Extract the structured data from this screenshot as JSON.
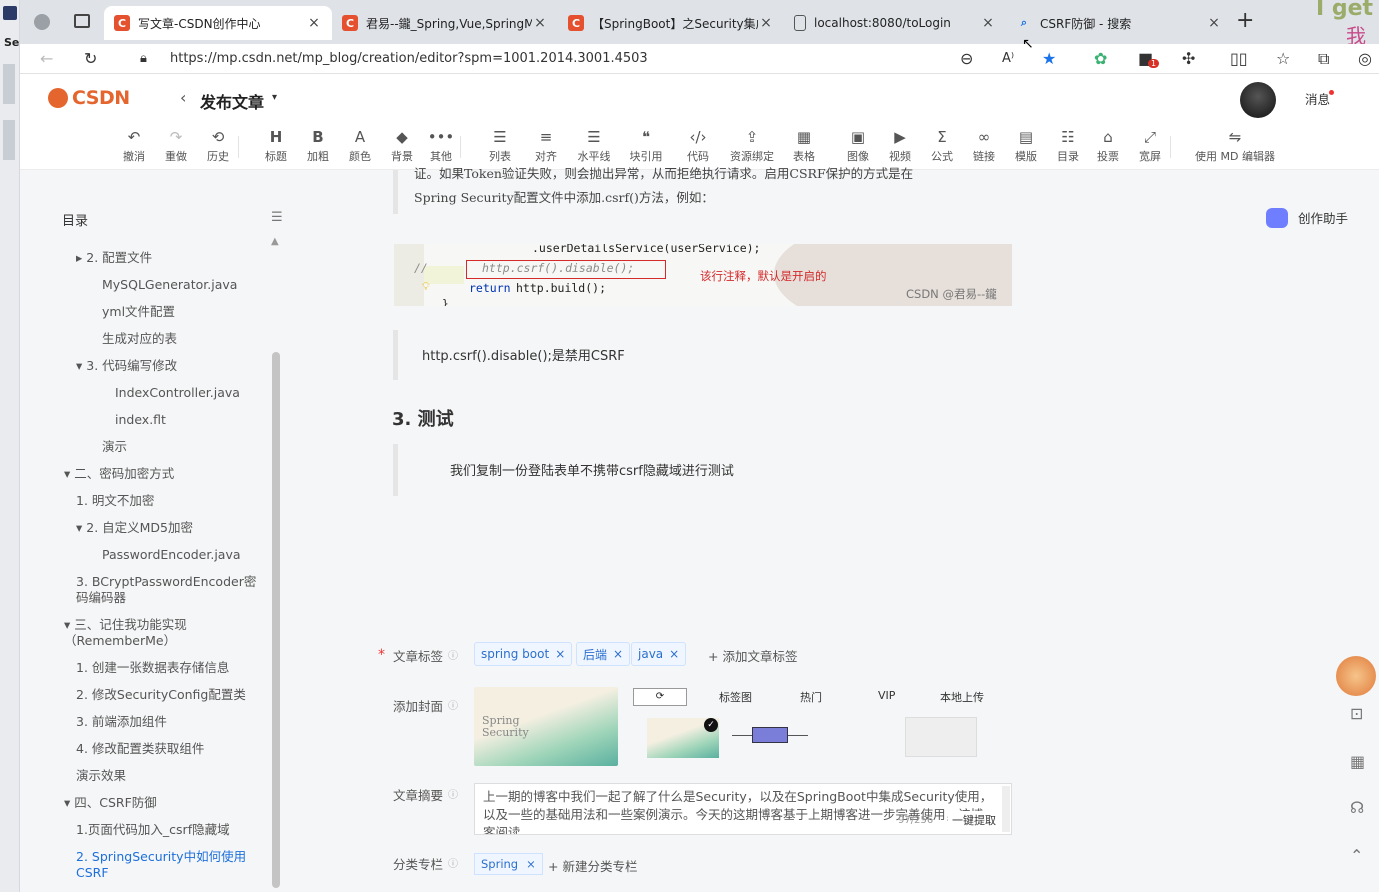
{
  "browser": {
    "tabs": [
      {
        "title": "写文章-CSDN创作中心",
        "icon": "csdn-icon",
        "active": true
      },
      {
        "title": "君易--鑨_Spring,Vue,SpringMVC",
        "icon": "csdn-icon",
        "active": false
      },
      {
        "title": "【SpringBoot】之Security集成",
        "icon": "csdn-icon",
        "active": false
      },
      {
        "title": "localhost:8080/toLogin",
        "icon": "page-icon",
        "active": false
      },
      {
        "title": "CSRF防御 - 搜索",
        "icon": "search-icon",
        "active": false
      }
    ],
    "url": "https://mp.csdn.net/mp_blog/creation/editor?spm=1001.2014.3001.4503",
    "extension_badge": "1"
  },
  "header": {
    "logo_text": "CSDN",
    "page_title": "发布文章",
    "messages_label": "消息"
  },
  "toolbar": [
    {
      "icon": "undo-icon",
      "label": "撤消"
    },
    {
      "icon": "redo-icon",
      "label": "重做"
    },
    {
      "icon": "history-icon",
      "label": "历史"
    },
    {
      "icon": "heading-icon",
      "label": "标题"
    },
    {
      "icon": "bold-icon",
      "label": "加粗"
    },
    {
      "icon": "font-color-icon",
      "label": "颜色"
    },
    {
      "icon": "fill-icon",
      "label": "背景"
    },
    {
      "icon": "more-icon",
      "label": "其他"
    },
    {
      "icon": "list-icon",
      "label": "列表"
    },
    {
      "icon": "align-icon",
      "label": "对齐"
    },
    {
      "icon": "hr-icon",
      "label": "水平线"
    },
    {
      "icon": "quote-icon",
      "label": "块引用"
    },
    {
      "icon": "code-icon",
      "label": "代码"
    },
    {
      "icon": "resource-icon",
      "label": "资源绑定"
    },
    {
      "icon": "table-icon",
      "label": "表格"
    },
    {
      "icon": "image-icon",
      "label": "图像"
    },
    {
      "icon": "video-icon",
      "label": "视频"
    },
    {
      "icon": "formula-icon",
      "label": "公式"
    },
    {
      "icon": "link-icon",
      "label": "链接"
    },
    {
      "icon": "template-icon",
      "label": "模版"
    },
    {
      "icon": "toc-icon",
      "label": "目录"
    },
    {
      "icon": "vote-icon",
      "label": "投票"
    },
    {
      "icon": "widescreen-icon",
      "label": "宽屏"
    },
    {
      "icon": "md-switch-icon",
      "label": "使用 MD 编辑器"
    }
  ],
  "toc": {
    "title": "目录",
    "items": [
      {
        "text": "▸ 2. 配置文件",
        "level": 2
      },
      {
        "text": "MySQLGenerator.java",
        "level": 3
      },
      {
        "text": "yml文件配置",
        "level": 3
      },
      {
        "text": "生成对应的表",
        "level": 3
      },
      {
        "text": "▾ 3. 代码编写修改",
        "level": 2
      },
      {
        "text": "IndexController.java",
        "level": 4
      },
      {
        "text": "index.flt",
        "level": 4
      },
      {
        "text": "演示",
        "level": 3
      },
      {
        "text": "▾ 二、密码加密方式",
        "level": 1
      },
      {
        "text": "1. 明文不加密",
        "level": 2
      },
      {
        "text": "▾ 2. 自定义MD5加密",
        "level": 2
      },
      {
        "text": "PasswordEncoder.java",
        "level": 3
      },
      {
        "text": "3. BCryptPasswordEncoder密码编码器",
        "level": 2
      },
      {
        "text": "▾ 三、记住我功能实现（RememberMe）",
        "level": 1
      },
      {
        "text": "1. 创建一张数据表存储信息",
        "level": 2
      },
      {
        "text": "2. 修改SecurityConfig配置类",
        "level": 2
      },
      {
        "text": "3. 前端添加组件",
        "level": 2
      },
      {
        "text": "4. 修改配置类获取组件",
        "level": 2
      },
      {
        "text": "演示效果",
        "level": 2
      },
      {
        "text": "▾ 四、CSRF防御",
        "level": 1
      },
      {
        "text": "1.页面代码加入_csrf隐藏域",
        "level": 2
      },
      {
        "text": "2. SpringSecurity中如何使用CSRF",
        "level": 2,
        "current": true
      }
    ]
  },
  "article": {
    "para_line1": "证。如果Token验证失败，则会抛出异常，从而拒绝执行请求。启用CSRF保护的方式是在",
    "para_line2": "Spring Security配置文件中添加.csrf()方法，例如：",
    "code_line1": ".userDetailsService(userService);",
    "code_comment_marker": "//",
    "code_line2": "http.csrf().disable();",
    "code_line3_kw": "return",
    "code_line3": "http.build();",
    "code_brace": "}",
    "image_annotation": "该行注释，默认是开启的",
    "image_watermark": "CSDN @君易--鑨",
    "quote1": "http.csrf().disable();是禁用CSRF",
    "heading": "3. 测试",
    "quote2": "我们复制一份登陆表单不携带csrf隐藏域进行测试"
  },
  "assistant_label": "创作助手",
  "form": {
    "tags_label": "文章标签",
    "tags": [
      "spring boot",
      "后端",
      "java"
    ],
    "add_tag": "+ 添加文章标签",
    "cover_label": "添加封面",
    "cover_tabs": [
      "标签图",
      "热门",
      "VIP",
      "本地上传"
    ],
    "cover_image_text": "Spring Security",
    "summary_label": "文章摘要",
    "summary_text": "上一期的博客中我们一起了解了什么是Security，以及在SpringBoot中集成Security使用，以及一些的基础用法和一些案例演示。今天的这期博客基于上期博客进一步完善使用，该博客阅读",
    "summary_count": "97/256",
    "extract_button": "一键提取",
    "column_label": "分类专栏",
    "column_tags": [
      "Spring"
    ],
    "add_column": "+ 新建分类专栏"
  },
  "desktop_overlay": {
    "top_right_text": "I get",
    "top_right_text2": "我"
  }
}
